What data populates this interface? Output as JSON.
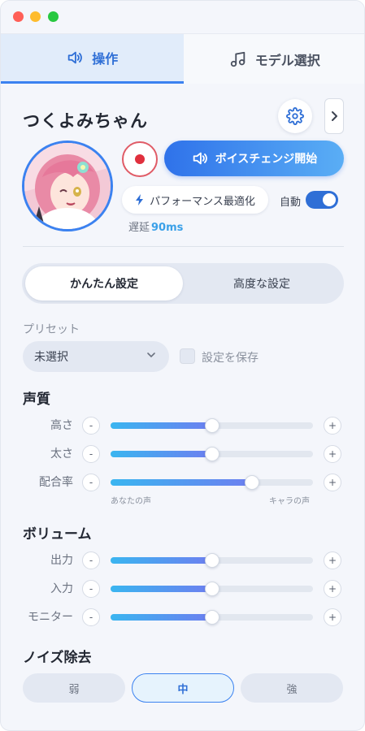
{
  "tabs": [
    {
      "label": "操作",
      "icon": "speaker-icon",
      "active": true
    },
    {
      "label": "モデル選択",
      "icon": "music-note-icon",
      "active": false
    }
  ],
  "character": {
    "name": "つくよみちゃん"
  },
  "controls": {
    "voice_change_label": "ボイスチェンジ開始",
    "performance_label": "パフォーマンス最適化",
    "auto_label": "自動",
    "auto_enabled": true,
    "latency_label": "遅延",
    "latency_value": "90ms"
  },
  "mode_tabs": [
    {
      "label": "かんたん設定",
      "active": true
    },
    {
      "label": "高度な設定",
      "active": false
    }
  ],
  "preset": {
    "label": "プリセット",
    "selected": "未選択",
    "save_label": "設定を保存",
    "save_checked": false
  },
  "voice_quality": {
    "title": "声質",
    "sliders": [
      {
        "label": "高さ",
        "value": 0.5
      },
      {
        "label": "太さ",
        "value": 0.5
      },
      {
        "label": "配合率",
        "value": 0.7
      }
    ],
    "mix_left_label": "あなたの声",
    "mix_right_label": "キャラの声"
  },
  "volume": {
    "title": "ボリューム",
    "sliders": [
      {
        "label": "出力",
        "value": 0.5
      },
      {
        "label": "入力",
        "value": 0.5
      },
      {
        "label": "モニター",
        "value": 0.5
      }
    ]
  },
  "noise": {
    "title": "ノイズ除去",
    "options": [
      {
        "label": "弱",
        "active": false
      },
      {
        "label": "中",
        "active": true
      },
      {
        "label": "強",
        "active": false
      }
    ]
  },
  "symbols": {
    "minus": "-",
    "plus": "+"
  },
  "colors": {
    "accent": "#2f6fd6",
    "record": "#e0303d",
    "slider_start": "#3ab5f0",
    "slider_end": "#6d7ff0"
  }
}
